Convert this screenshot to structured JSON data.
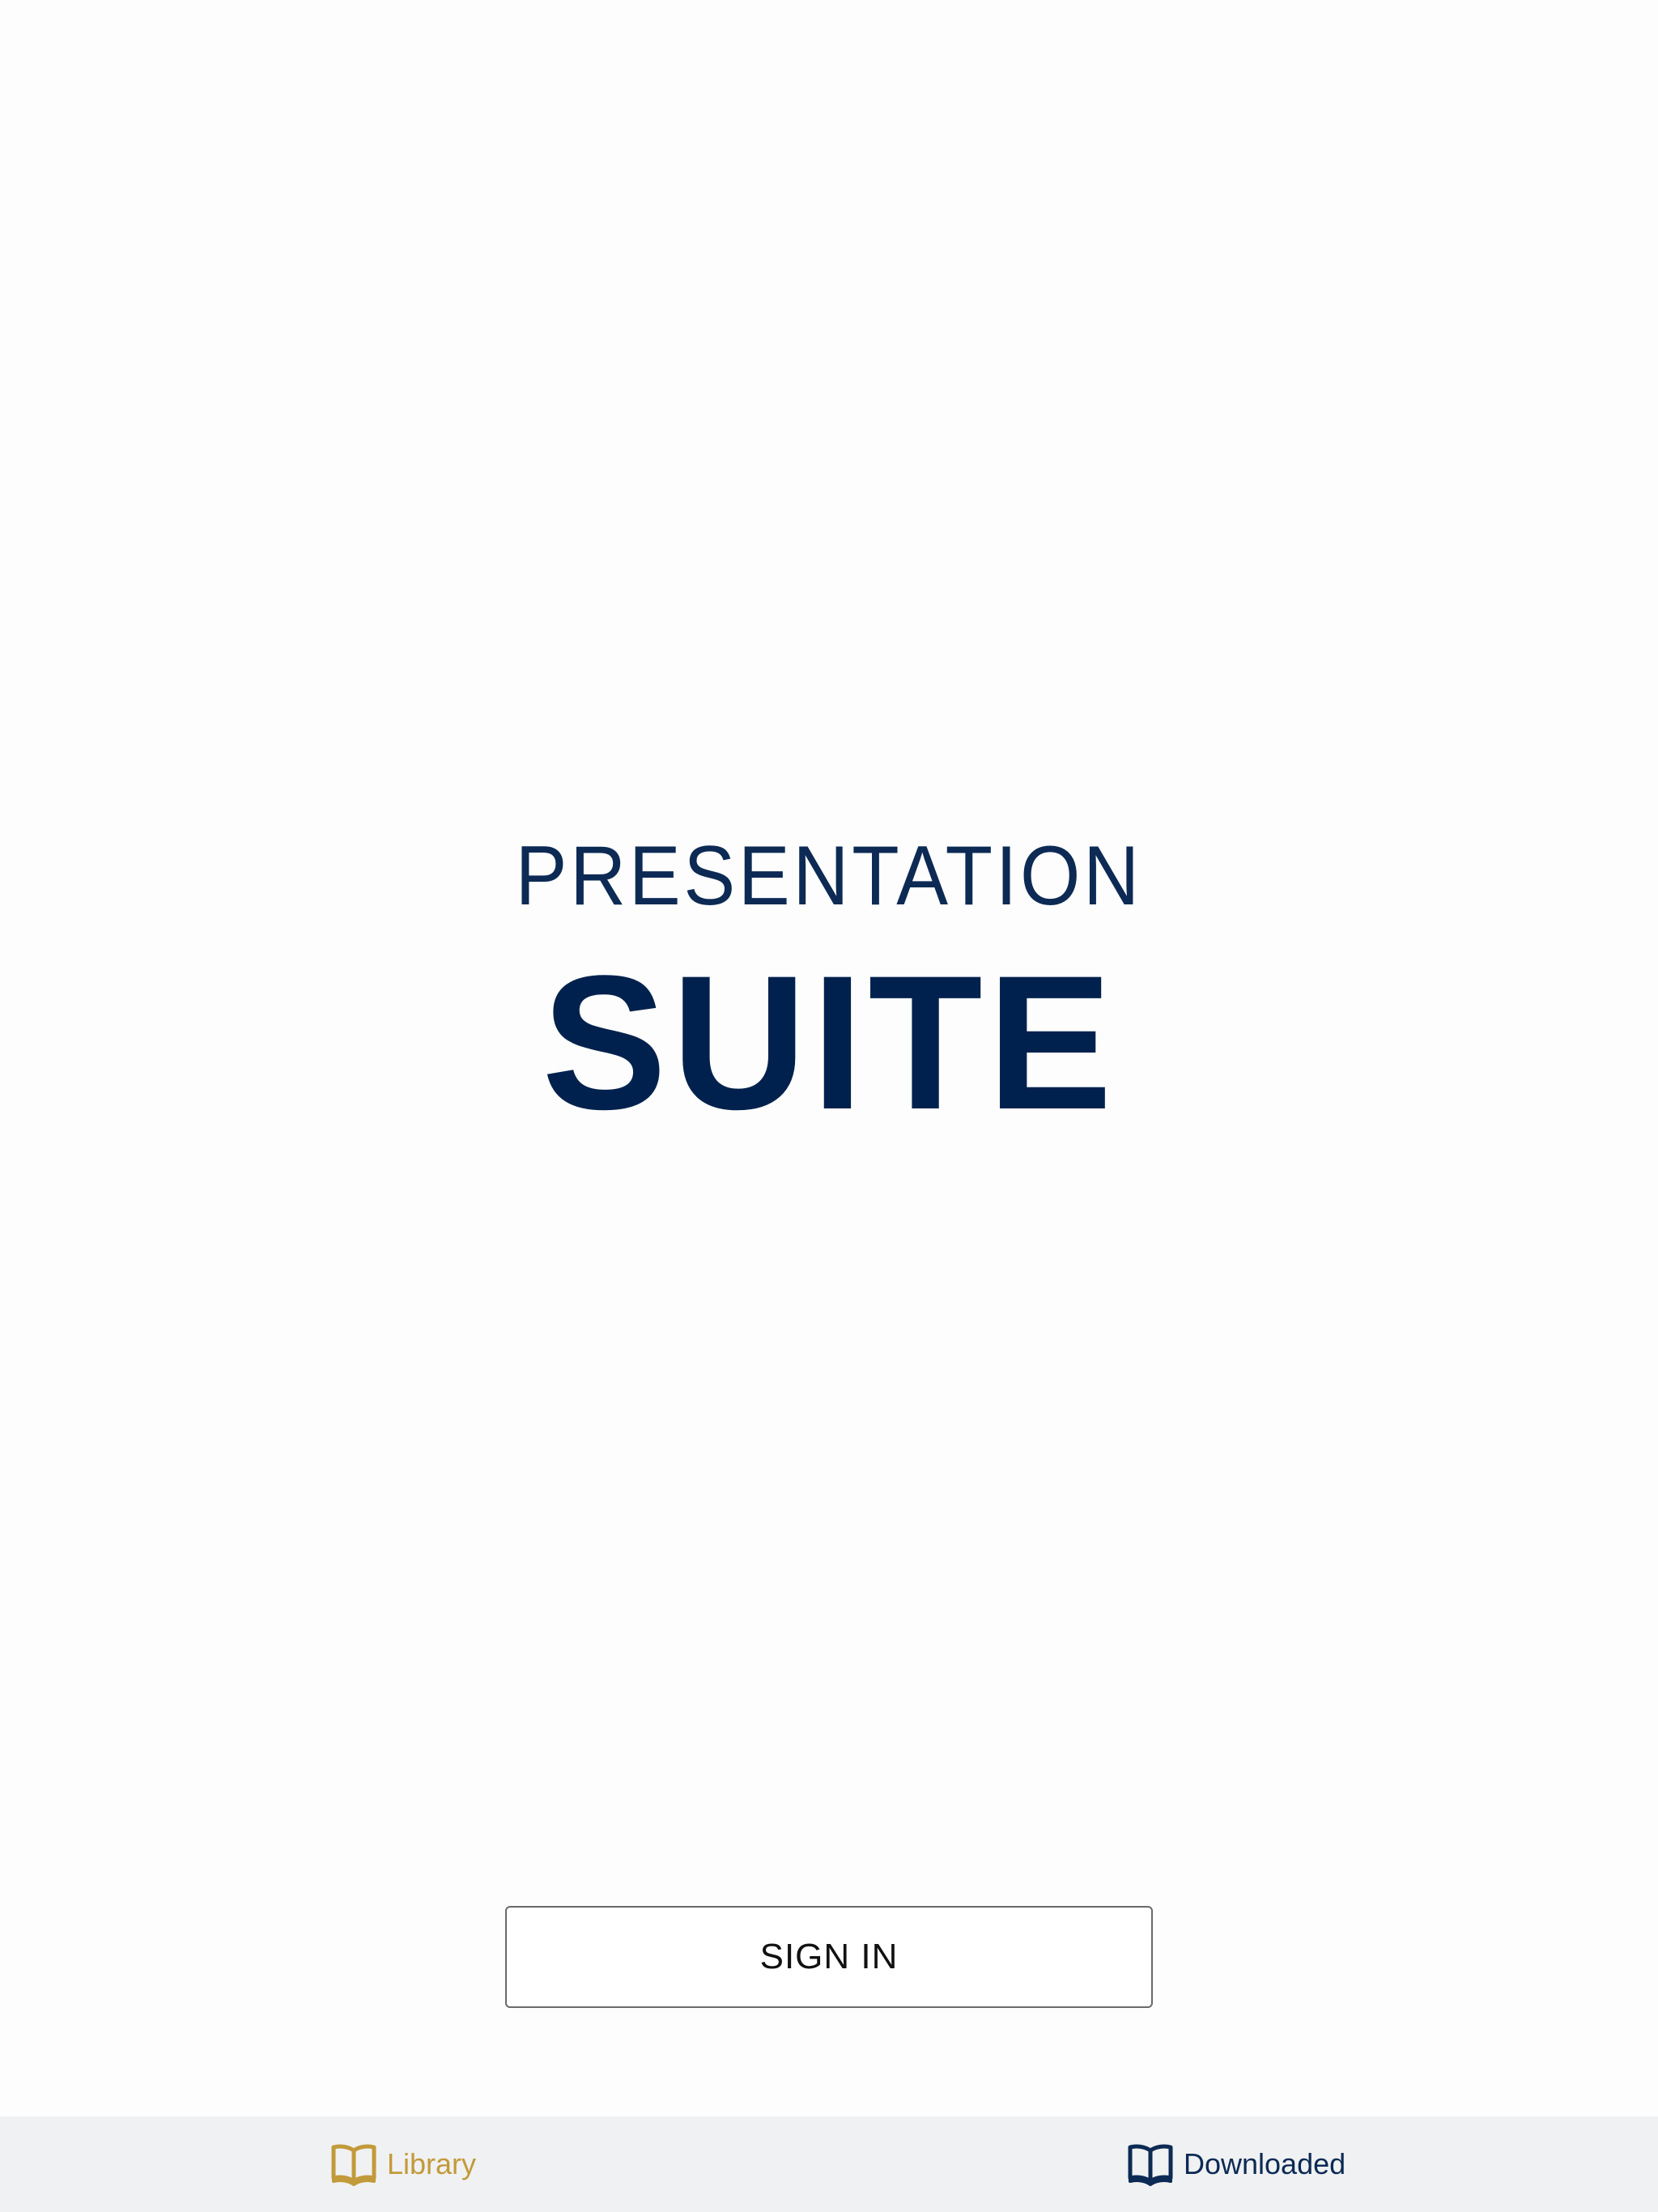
{
  "logo": {
    "line1": "PRESENTATION",
    "line2": "SUITE"
  },
  "signin": {
    "label": "SIGN IN"
  },
  "tabbar": {
    "tabs": [
      {
        "label": "Library",
        "icon": "open-book-icon",
        "color": "#c29a3a",
        "selected": true
      },
      {
        "label": "Downloaded",
        "icon": "open-book-icon",
        "color": "#0c2a54",
        "selected": false
      }
    ]
  },
  "colors": {
    "brand_navy": "#00214d",
    "accent_gold": "#c29a3a",
    "background": "#fdfdfd",
    "tabbar_background": "#f0f1f2"
  }
}
